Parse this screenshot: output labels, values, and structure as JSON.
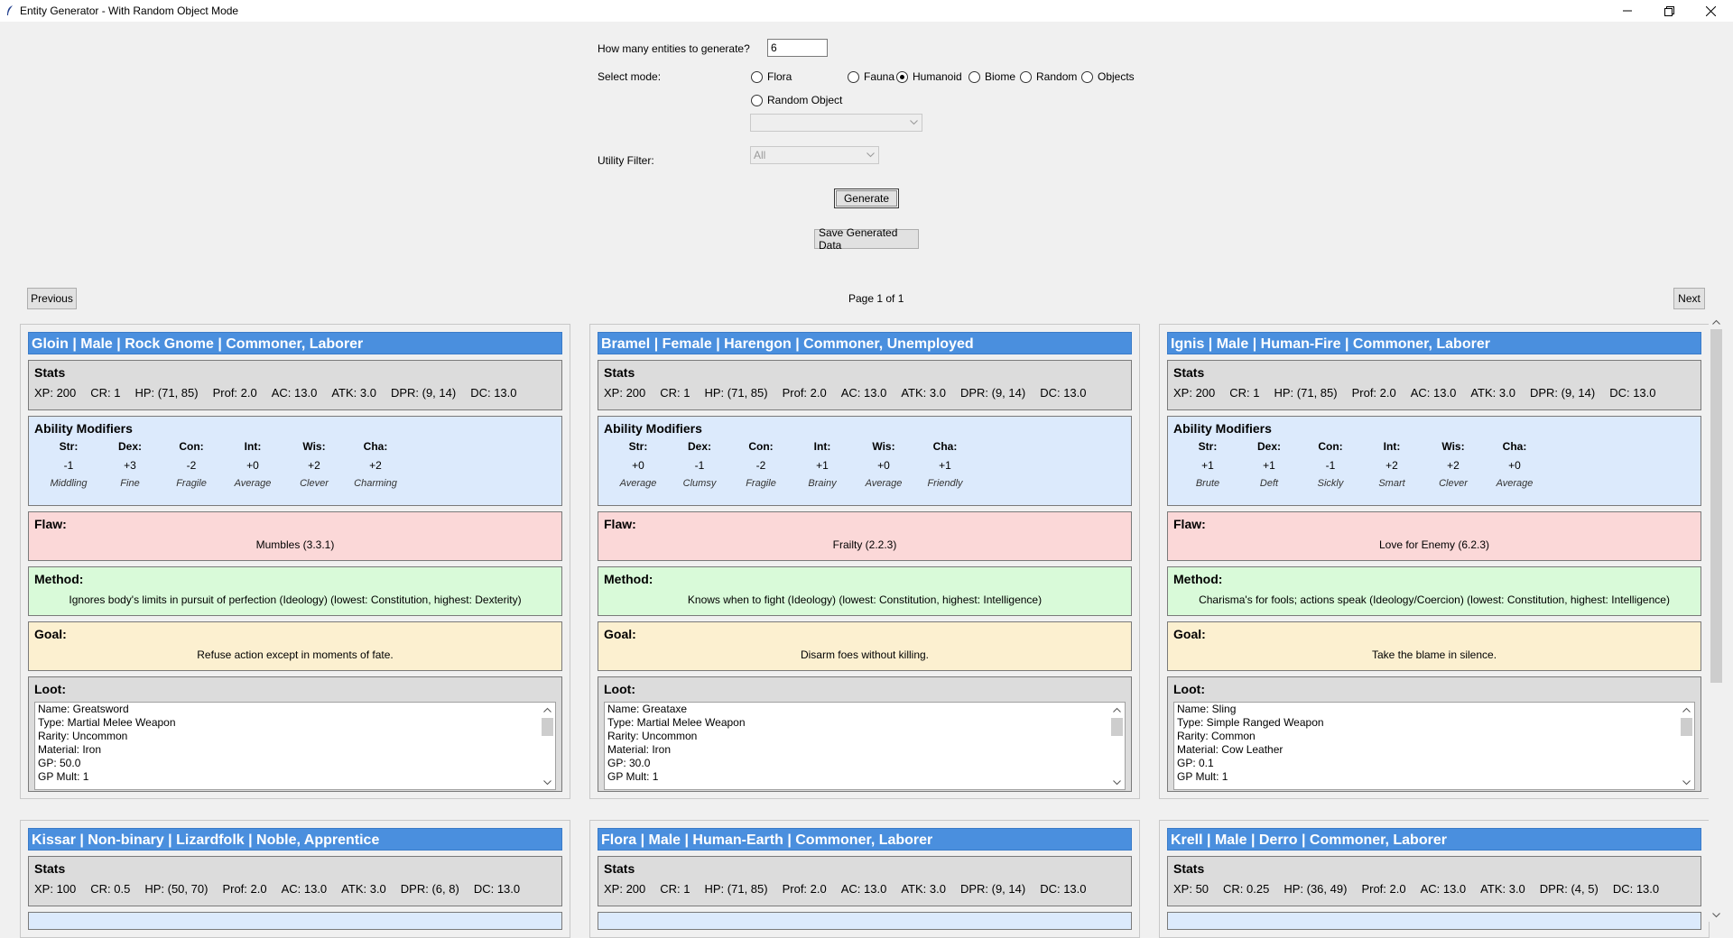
{
  "window": {
    "title": "Entity Generator - With Random Object Mode"
  },
  "form": {
    "count_label": "How many entities to generate?",
    "count_value": "6",
    "mode_label": "Select mode:",
    "modes": [
      {
        "label": "Flora",
        "selected": false
      },
      {
        "label": "Fauna",
        "selected": false
      },
      {
        "label": "Humanoid",
        "selected": true
      },
      {
        "label": "Biome",
        "selected": false
      },
      {
        "label": "Random",
        "selected": false
      },
      {
        "label": "Objects",
        "selected": false
      },
      {
        "label": "Random Object",
        "selected": false
      }
    ],
    "object_combo_value": "",
    "utility_label": "Utility Filter:",
    "utility_value": "All",
    "generate_label": "Generate",
    "save_label": "Save Generated Data"
  },
  "pager": {
    "previous_label": "Previous",
    "next_label": "Next",
    "page_text": "Page 1 of 1"
  },
  "section_titles": {
    "stats": "Stats",
    "ability": "Ability Modifiers",
    "flaw": "Flaw:",
    "method": "Method:",
    "goal": "Goal:",
    "loot": "Loot:"
  },
  "ability_headers": [
    "Str:",
    "Dex:",
    "Con:",
    "Int:",
    "Wis:",
    "Cha:"
  ],
  "cards": [
    {
      "header": "Gloin | Male | Rock Gnome | Commoner, Laborer",
      "stats": [
        "XP: 200",
        "CR: 1",
        "HP: (71, 85)",
        "Prof: 2.0",
        "AC: 13.0",
        "ATK: 3.0",
        "DPR: (9, 14)",
        "DC: 13.0"
      ],
      "abilities": [
        {
          "v": "-1",
          "d": "Middling"
        },
        {
          "v": "+3",
          "d": "Fine"
        },
        {
          "v": "-2",
          "d": "Fragile"
        },
        {
          "v": "+0",
          "d": "Average"
        },
        {
          "v": "+2",
          "d": "Clever"
        },
        {
          "v": "+2",
          "d": "Charming"
        }
      ],
      "flaw": "Mumbles (3.3.1)",
      "method": "Ignores body's limits in pursuit of perfection (Ideology) (lowest: Constitution, highest: Dexterity)",
      "goal": "Refuse action except in moments of fate.",
      "loot": [
        "Name: Greatsword",
        "Type: Martial Melee Weapon",
        "Rarity: Uncommon",
        "Material: Iron",
        "GP: 50.0",
        "GP Mult: 1"
      ]
    },
    {
      "header": "Bramel | Female | Harengon | Commoner, Unemployed",
      "stats": [
        "XP: 200",
        "CR: 1",
        "HP: (71, 85)",
        "Prof: 2.0",
        "AC: 13.0",
        "ATK: 3.0",
        "DPR: (9, 14)",
        "DC: 13.0"
      ],
      "abilities": [
        {
          "v": "+0",
          "d": "Average"
        },
        {
          "v": "-1",
          "d": "Clumsy"
        },
        {
          "v": "-2",
          "d": "Fragile"
        },
        {
          "v": "+1",
          "d": "Brainy"
        },
        {
          "v": "+0",
          "d": "Average"
        },
        {
          "v": "+1",
          "d": "Friendly"
        }
      ],
      "flaw": "Frailty (2.2.3)",
      "method": "Knows when to fight (Ideology) (lowest: Constitution, highest: Intelligence)",
      "goal": "Disarm foes without killing.",
      "loot": [
        "Name: Greataxe",
        "Type: Martial Melee Weapon",
        "Rarity: Uncommon",
        "Material: Iron",
        "GP: 30.0",
        "GP Mult: 1"
      ]
    },
    {
      "header": "Ignis | Male | Human-Fire | Commoner, Laborer",
      "stats": [
        "XP: 200",
        "CR: 1",
        "HP: (71, 85)",
        "Prof: 2.0",
        "AC: 13.0",
        "ATK: 3.0",
        "DPR: (9, 14)",
        "DC: 13.0"
      ],
      "abilities": [
        {
          "v": "+1",
          "d": "Brute"
        },
        {
          "v": "+1",
          "d": "Deft"
        },
        {
          "v": "-1",
          "d": "Sickly"
        },
        {
          "v": "+2",
          "d": "Smart"
        },
        {
          "v": "+2",
          "d": "Clever"
        },
        {
          "v": "+0",
          "d": "Average"
        }
      ],
      "flaw": "Love for Enemy (6.2.3)",
      "method": "Charisma's for fools; actions speak (Ideology/Coercion) (lowest: Constitution, highest: Intelligence)",
      "goal": "Take the blame in silence.",
      "loot": [
        "Name: Sling",
        "Type: Simple Ranged Weapon",
        "Rarity: Common",
        "Material: Cow Leather",
        "GP: 0.1",
        "GP Mult: 1"
      ]
    },
    {
      "header": "Kissar | Non-binary | Lizardfolk | Noble, Apprentice",
      "stats": [
        "XP: 100",
        "CR: 0.5",
        "HP: (50, 70)",
        "Prof: 2.0",
        "AC: 13.0",
        "ATK: 3.0",
        "DPR: (6, 8)",
        "DC: 13.0"
      ]
    },
    {
      "header": "Flora | Male | Human-Earth | Commoner, Laborer",
      "stats": [
        "XP: 200",
        "CR: 1",
        "HP: (71, 85)",
        "Prof: 2.0",
        "AC: 13.0",
        "ATK: 3.0",
        "DPR: (9, 14)",
        "DC: 13.0"
      ]
    },
    {
      "header": "Krell | Male | Derro | Commoner, Laborer",
      "stats": [
        "XP: 50",
        "CR: 0.25",
        "HP: (36, 49)",
        "Prof: 2.0",
        "AC: 13.0",
        "ATK: 3.0",
        "DPR: (4, 5)",
        "DC: 13.0"
      ]
    }
  ]
}
